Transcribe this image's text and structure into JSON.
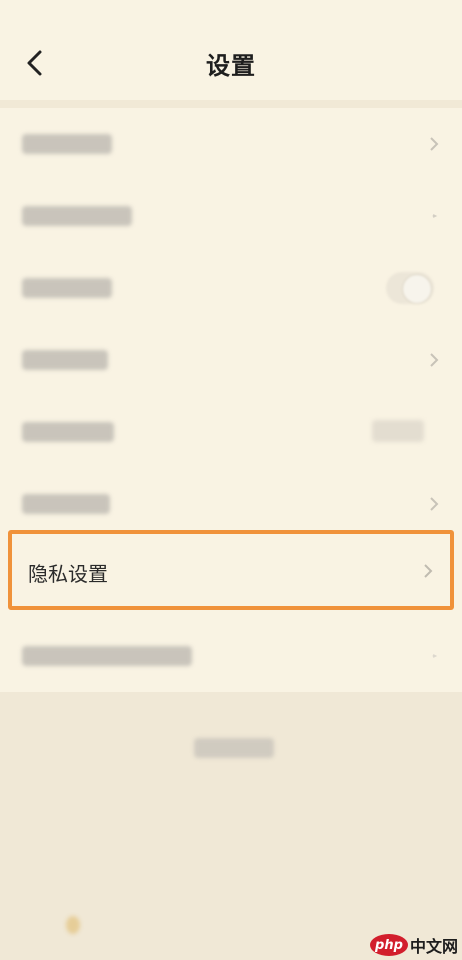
{
  "header": {
    "title": "设置"
  },
  "settings": {
    "privacy_label": "隐私设置"
  },
  "watermark": {
    "logo": "php",
    "text": "中文网"
  },
  "colors": {
    "background": "#f9f3e3",
    "highlight_border": "#f0923a"
  },
  "icons": {
    "back": "back-arrow-icon",
    "row": "chevron-right-icon"
  }
}
